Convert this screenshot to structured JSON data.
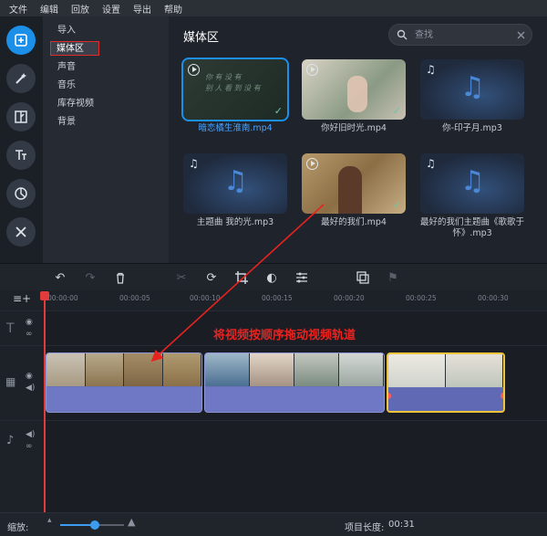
{
  "menu": [
    "文件",
    "编辑",
    "回放",
    "设置",
    "导出",
    "帮助"
  ],
  "categories": [
    "导入",
    "媒体区",
    "声音",
    "音乐",
    "库存视频",
    "背景"
  ],
  "media": {
    "title": "媒体区",
    "search_placeholder": "查找",
    "items": [
      {
        "name": "暗恋橘生淮南.mp4",
        "kind": "video",
        "selected": true,
        "checked": true,
        "thumb_text": "你 有 没 有\n别 人 看 到 没 有"
      },
      {
        "name": "你好旧时光.mp4",
        "kind": "video",
        "selected": false,
        "checked": true
      },
      {
        "name": "你-印子月.mp3",
        "kind": "audio",
        "selected": false,
        "checked": false
      },
      {
        "name": "主题曲 我的光.mp3",
        "kind": "audio",
        "selected": false,
        "checked": false
      },
      {
        "name": "最好的我们.mp4",
        "kind": "video",
        "selected": false,
        "checked": true
      },
      {
        "name": "最好的我们主题曲《歌歌于怀》.mp3",
        "kind": "audio",
        "selected": false,
        "checked": false
      }
    ]
  },
  "timeline": {
    "ruler": [
      "00:00:00",
      "00:00:05",
      "00:00:10",
      "00:00:15",
      "00:00:20",
      "00:00:25",
      "00:00:30"
    ],
    "annotation": "将视频按顺序拖动视频轨道"
  },
  "status": {
    "zoom_label": "缩放:",
    "project_length_label": "项目长度:",
    "project_length": "00:31"
  },
  "colors": {
    "accent": "#1c8fe8",
    "annotation": "#e8231f",
    "selected_clip": "#f0c43a"
  }
}
